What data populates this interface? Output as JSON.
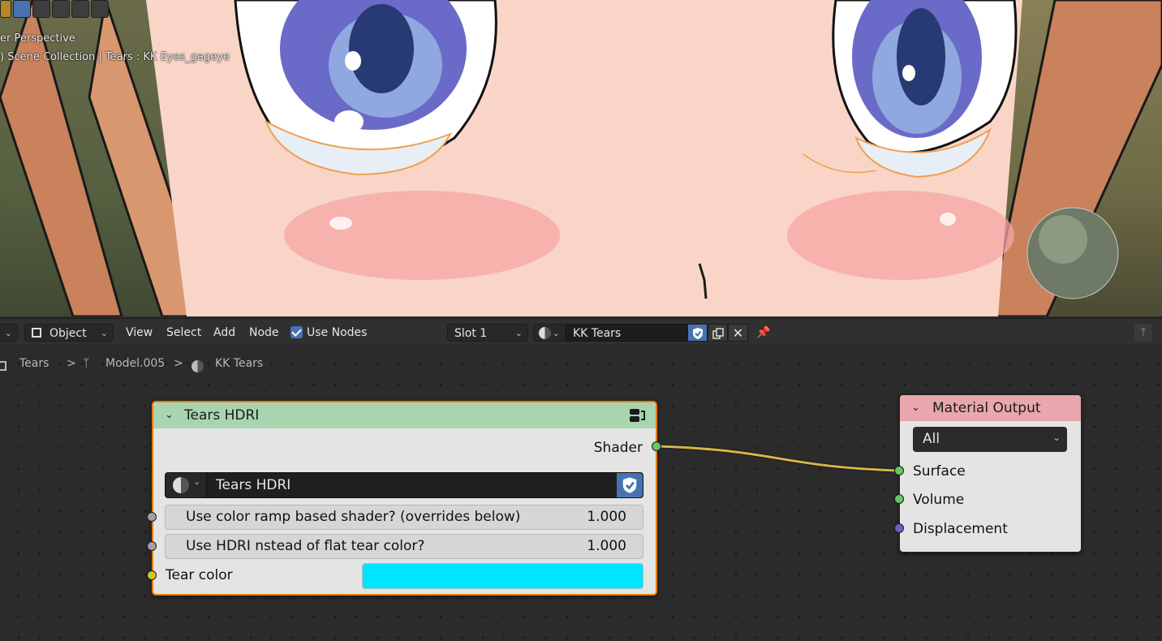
{
  "viewport": {
    "perspective_label": "er Perspective",
    "collection_label": ") Scene Collection | Tears : KK Eyes_gageye"
  },
  "header": {
    "mode_dropdown": "Object",
    "menus": [
      "View",
      "Select",
      "Add",
      "Node"
    ],
    "use_nodes_label": "Use Nodes",
    "use_nodes_checked": true,
    "slot_dropdown": "Slot 1",
    "material_name": "KK Tears"
  },
  "breadcrumb": {
    "items": [
      "Tears",
      "Model.005",
      "KK Tears"
    ],
    "separator": ">"
  },
  "nodes": {
    "group": {
      "title": "Tears HDRI",
      "header_color": "#a8d5b0",
      "output_label": "Shader",
      "datablock_name": "Tears HDRI",
      "inputs": [
        {
          "label": "Use color ramp based shader? (overrides below)",
          "value": "1.000"
        },
        {
          "label": "Use HDRI nstead of flat tear color?",
          "value": "1.000"
        }
      ],
      "color_input_label": "Tear color",
      "color_value": "#00e5ff"
    },
    "output": {
      "title": "Material Output",
      "header_color": "#e8a7ac",
      "target_dropdown": "All",
      "inputs": [
        "Surface",
        "Volume",
        "Displacement"
      ]
    }
  },
  "colors": {
    "shader_socket": "#63c763",
    "float_socket": "#a1a1a1",
    "color_socket": "#c7c729",
    "vector_socket": "#6363c7",
    "link": "#d8b54a",
    "selected_outline": "#e87d0d"
  }
}
